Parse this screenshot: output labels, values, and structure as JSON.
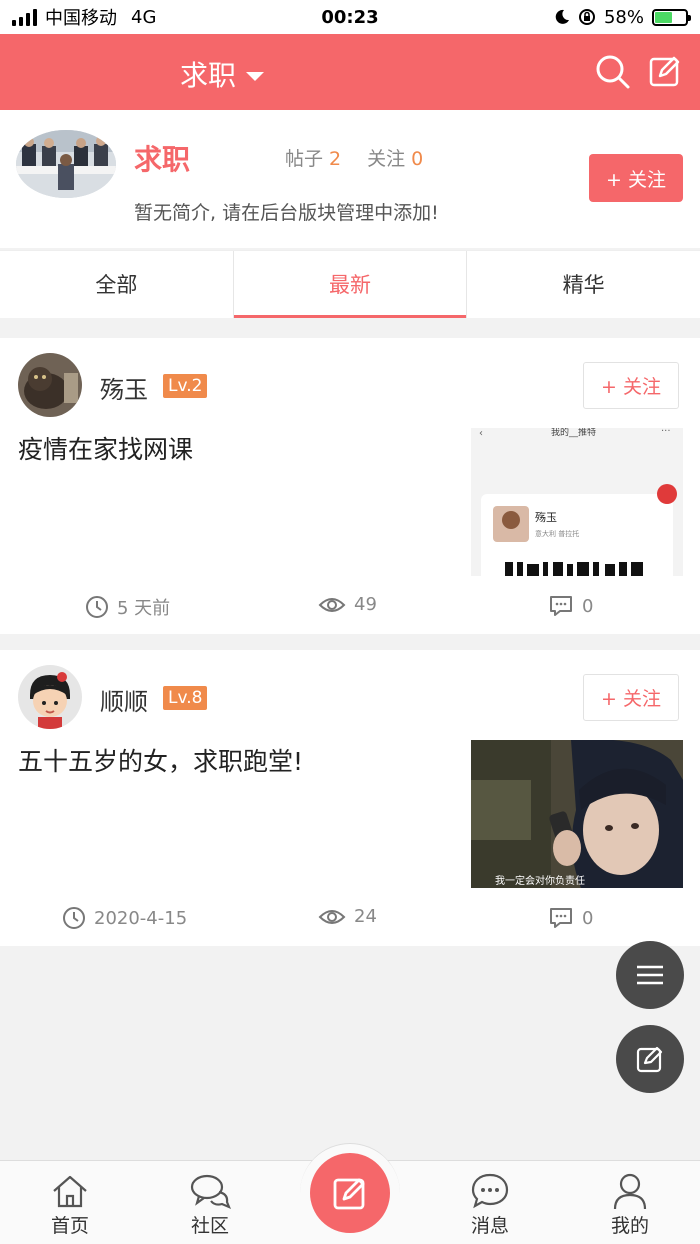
{
  "status_bar": {
    "carrier": "中国移动",
    "network": "4G",
    "time": "00:23",
    "battery_percent": "58%"
  },
  "header": {
    "title": "求职"
  },
  "board": {
    "name": "求职",
    "posts_label": "帖子",
    "posts_count": "2",
    "follow_label": "关注",
    "follow_count": "0",
    "description": "暂无简介, 请在后台版块管理中添加!",
    "follow_button": "+ 关注"
  },
  "tabs": [
    {
      "label": "全部",
      "active": false
    },
    {
      "label": "最新",
      "active": true
    },
    {
      "label": "精华",
      "active": false
    }
  ],
  "posts": [
    {
      "author": "殇玉",
      "level": "Lv.2",
      "follow_button": "+ 关注",
      "title": "疫情在家找网课",
      "time": "5 天前",
      "views": "49",
      "comments": "0",
      "thumb": {
        "header": "我的__推特",
        "name": "殇玉",
        "sub": "意大利 普拉托"
      }
    },
    {
      "author": "顺顺",
      "level": "Lv.8",
      "follow_button": "+ 关注",
      "title": "五十五岁的女，求职跑堂!",
      "time": "2020-4-15",
      "views": "24",
      "comments": "0",
      "thumb": {
        "caption": "我一定会对你负责任"
      }
    }
  ],
  "bottom_nav": [
    {
      "label": "首页",
      "icon": "home-icon"
    },
    {
      "label": "社区",
      "icon": "chat-bubbles-icon"
    },
    {
      "label": "消息",
      "icon": "message-icon"
    },
    {
      "label": "我的",
      "icon": "user-icon"
    }
  ],
  "colors": {
    "accent": "#f5676a",
    "badge": "#f08a4b",
    "fab": "#4a4a4a"
  }
}
